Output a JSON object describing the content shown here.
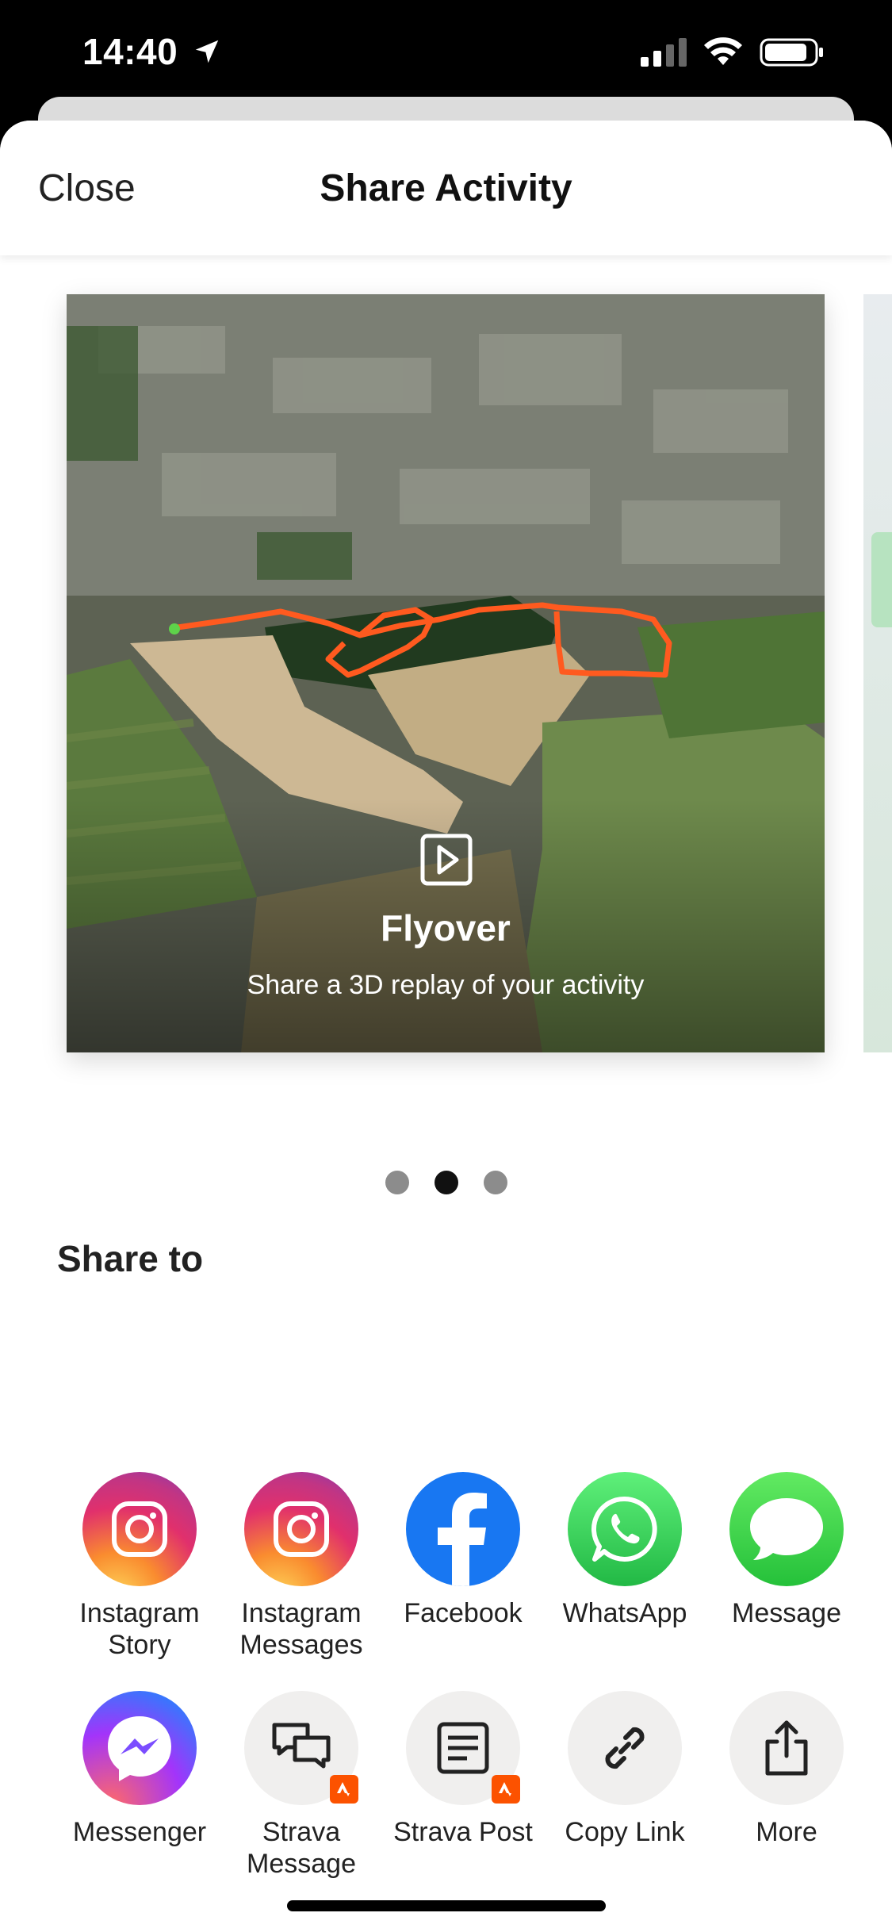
{
  "status_bar": {
    "time": "14:40"
  },
  "nav": {
    "close_label": "Close",
    "title": "Share Activity"
  },
  "carousel": {
    "card": {
      "title": "Flyover",
      "subtitle": "Share a 3D replay of your activity"
    },
    "pages": 3,
    "active_page": 2
  },
  "share": {
    "heading": "Share to",
    "row1": [
      {
        "label": "Instagram Story",
        "icon": "instagram-icon"
      },
      {
        "label": "Instagram Messages",
        "icon": "instagram-icon"
      },
      {
        "label": "Facebook",
        "icon": "facebook-icon"
      },
      {
        "label": "WhatsApp",
        "icon": "whatsapp-icon"
      },
      {
        "label": "Message",
        "icon": "message-icon"
      }
    ],
    "row2": [
      {
        "label": "Messenger",
        "icon": "messenger-icon"
      },
      {
        "label": "Strava Message",
        "icon": "strava-message-icon"
      },
      {
        "label": "Strava Post",
        "icon": "strava-post-icon"
      },
      {
        "label": "Copy Link",
        "icon": "link-icon"
      },
      {
        "label": "More",
        "icon": "share-icon"
      }
    ]
  },
  "colors": {
    "strava_orange": "#fc5200",
    "route": "#ff5a1f",
    "facebook": "#1877f2",
    "whatsapp": "#25d366"
  }
}
